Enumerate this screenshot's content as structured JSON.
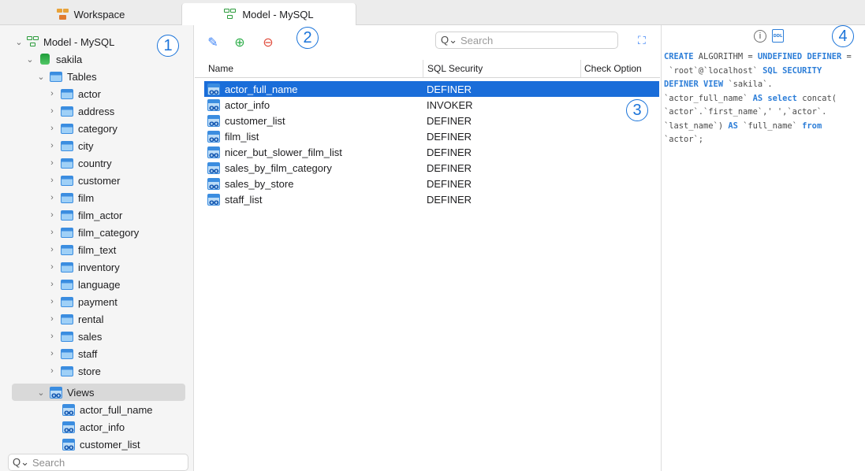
{
  "tabs": [
    {
      "label": "Workspace",
      "icon": "workspace-icon"
    },
    {
      "label": "Model - MySQL",
      "icon": "model-icon"
    }
  ],
  "sidebar": {
    "root": {
      "label": "Model - MySQL"
    },
    "schema": {
      "label": "sakila"
    },
    "tables_group": {
      "label": "Tables"
    },
    "tables": [
      "actor",
      "address",
      "category",
      "city",
      "country",
      "customer",
      "film",
      "film_actor",
      "film_category",
      "film_text",
      "inventory",
      "language",
      "payment",
      "rental",
      "sales",
      "staff",
      "store"
    ],
    "views_group": {
      "label": "Views"
    },
    "views": [
      "actor_full_name",
      "actor_info",
      "customer_list"
    ],
    "search_placeholder": "Search"
  },
  "toolbar": {
    "edit_icon": "pencil-icon",
    "add_icon": "plus-circle-icon",
    "remove_icon": "minus-circle-icon",
    "search_placeholder": "Search",
    "expand_icon": "expand-icon"
  },
  "view_list": {
    "columns": [
      "Name",
      "SQL Security",
      "Check Option"
    ],
    "rows": [
      {
        "name": "actor_full_name",
        "security": "DEFINER",
        "selected": true
      },
      {
        "name": "actor_info",
        "security": "INVOKER"
      },
      {
        "name": "customer_list",
        "security": "DEFINER"
      },
      {
        "name": "film_list",
        "security": "DEFINER"
      },
      {
        "name": "nicer_but_slower_film_list",
        "security": "DEFINER"
      },
      {
        "name": "sales_by_film_category",
        "security": "DEFINER"
      },
      {
        "name": "sales_by_store",
        "security": "DEFINER"
      },
      {
        "name": "staff_list",
        "security": "DEFINER"
      }
    ]
  },
  "inspector": {
    "info_icon": "info-icon",
    "ddl_icon": "ddl-icon",
    "ddl_badge": "DDL",
    "sql_lines": [
      [
        [
          "kw",
          "CREATE"
        ],
        [
          "t",
          " ALGORITHM = "
        ],
        [
          "kw",
          "UNDEFINED"
        ],
        [
          "t",
          " "
        ],
        [
          "kw",
          "DEFINER"
        ],
        [
          "t",
          " ="
        ]
      ],
      [
        [
          "t",
          " `root`@`localhost` "
        ],
        [
          "kw",
          "SQL SECURITY"
        ]
      ],
      [
        [
          "kw",
          "DEFINER VIEW"
        ],
        [
          "t",
          " `sakila`."
        ]
      ],
      [
        [
          "t",
          "`actor_full_name` "
        ],
        [
          "kw",
          "AS"
        ],
        [
          "t",
          " "
        ],
        [
          "kw",
          "select"
        ],
        [
          "t",
          " concat("
        ]
      ],
      [
        [
          "t",
          "`actor`.`first_name`,' ',`actor`."
        ]
      ],
      [
        [
          "t",
          "`last_name`) "
        ],
        [
          "kw",
          "AS"
        ],
        [
          "t",
          " `full_name` "
        ],
        [
          "kw",
          "from"
        ]
      ],
      [
        [
          "t",
          "`actor`;"
        ]
      ]
    ]
  },
  "callouts": [
    "1",
    "2",
    "3",
    "4"
  ],
  "colors": {
    "accent": "#1a6dd9",
    "keyword": "#2d7ed8",
    "callout": "#1a73d9"
  }
}
